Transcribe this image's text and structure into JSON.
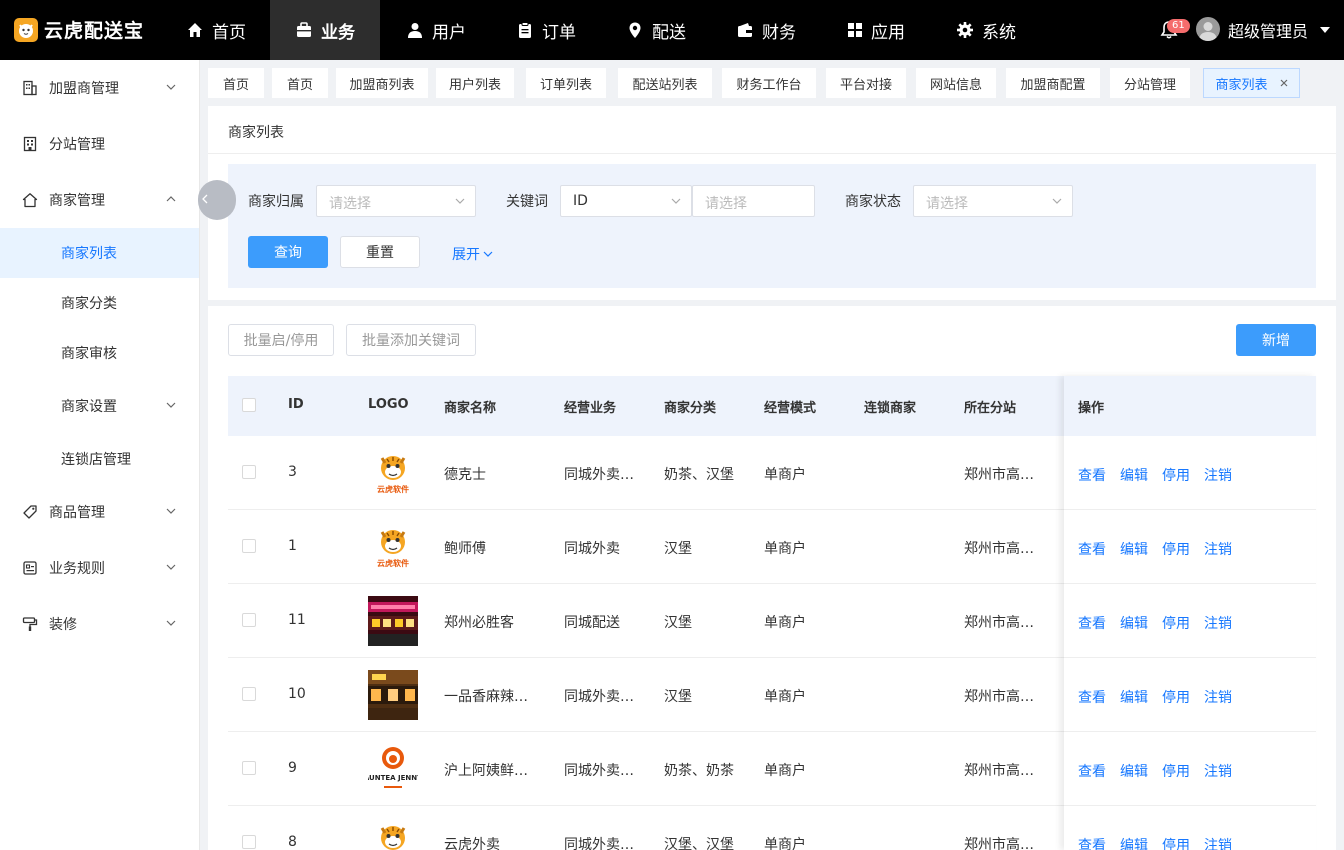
{
  "app": {
    "name": "云虎配送宝"
  },
  "nav": {
    "items": [
      {
        "label": "首页",
        "icon": "home-icon"
      },
      {
        "label": "业务",
        "icon": "briefcase-icon"
      },
      {
        "label": "用户",
        "icon": "user-icon"
      },
      {
        "label": "订单",
        "icon": "clipboard-icon"
      },
      {
        "label": "配送",
        "icon": "location-pin-icon"
      },
      {
        "label": "财务",
        "icon": "wallet-icon"
      },
      {
        "label": "应用",
        "icon": "grid-icon"
      },
      {
        "label": "系统",
        "icon": "gear-icon"
      }
    ],
    "active": "业务"
  },
  "header": {
    "notification_count": "61",
    "username": "超级管理员"
  },
  "sidebar": {
    "items": [
      {
        "label": "加盟商管理"
      },
      {
        "label": "分站管理"
      },
      {
        "label": "商家管理"
      },
      {
        "label": "商家列表"
      },
      {
        "label": "商家分类"
      },
      {
        "label": "商家审核"
      },
      {
        "label": "商家设置"
      },
      {
        "label": "连锁店管理"
      },
      {
        "label": "商品管理"
      },
      {
        "label": "业务规则"
      },
      {
        "label": "装修"
      }
    ]
  },
  "tabs": [
    {
      "label": "首页"
    },
    {
      "label": "首页"
    },
    {
      "label": "加盟商列表"
    },
    {
      "label": "用户列表"
    },
    {
      "label": "订单列表"
    },
    {
      "label": "配送站列表"
    },
    {
      "label": "财务工作台"
    },
    {
      "label": "平台对接"
    },
    {
      "label": "网站信息"
    },
    {
      "label": "加盟商配置"
    },
    {
      "label": "分站管理"
    },
    {
      "label": "商家列表"
    }
  ],
  "page": {
    "title": "商家列表"
  },
  "filters": {
    "owner_label": "商家归属",
    "owner_placeholder": "请选择",
    "keyword_label": "关键词",
    "keyword_type": "ID",
    "keyword_placeholder": "请选择",
    "status_label": "商家状态",
    "status_placeholder": "请选择",
    "query_button": "查询",
    "reset_button": "重置",
    "expand_link": "展开"
  },
  "toolbar": {
    "batch_toggle": "批量启/停用",
    "batch_keyword": "批量添加关键词",
    "add_button": "新增"
  },
  "table": {
    "columns": [
      "ID",
      "LOGO",
      "商家名称",
      "经营业务",
      "商家分类",
      "经营模式",
      "连锁商家",
      "所在分站",
      "操作"
    ],
    "actions": [
      "查看",
      "编辑",
      "停用",
      "注销"
    ],
    "rows": [
      {
        "id": "3",
        "logo": "tiger-logo",
        "logo_text": "云虎软件",
        "name": "德克士",
        "business": "同城外卖…",
        "category": "奶茶、汉堡",
        "mode": "单商户",
        "chain": "",
        "station": "郑州市高…"
      },
      {
        "id": "1",
        "logo": "tiger-logo",
        "logo_text": "云虎软件",
        "name": "鲍师傅",
        "business": "同城外卖",
        "category": "汉堡",
        "mode": "单商户",
        "chain": "",
        "station": "郑州市高…"
      },
      {
        "id": "11",
        "logo": "storefront-photo-red",
        "logo_text": "",
        "name": "郑州必胜客",
        "business": "同城配送",
        "category": "汉堡",
        "mode": "单商户",
        "chain": "",
        "station": "郑州市高…"
      },
      {
        "id": "10",
        "logo": "storefront-photo-brown",
        "logo_text": "",
        "name": "一品香麻辣…",
        "business": "同城外卖…",
        "category": "汉堡",
        "mode": "单商户",
        "chain": "",
        "station": "郑州市高…"
      },
      {
        "id": "9",
        "logo": "auntea-jenny-logo",
        "logo_text": "AUNTEA JENNY",
        "name": "沪上阿姨鲜…",
        "business": "同城外卖…",
        "category": "奶茶、奶茶",
        "mode": "单商户",
        "chain": "",
        "station": "郑州市高…"
      },
      {
        "id": "8",
        "logo": "tiger-logo",
        "logo_text": "云虎软件",
        "name": "云虎外卖",
        "business": "同城外卖…",
        "category": "汉堡、汉堡",
        "mode": "单商户",
        "chain": "",
        "station": "郑州市高…"
      }
    ]
  },
  "colors": {
    "primary": "#3c9cfc",
    "link": "#1677ff",
    "topbar": "#000000",
    "badge": "#f56c6c"
  }
}
